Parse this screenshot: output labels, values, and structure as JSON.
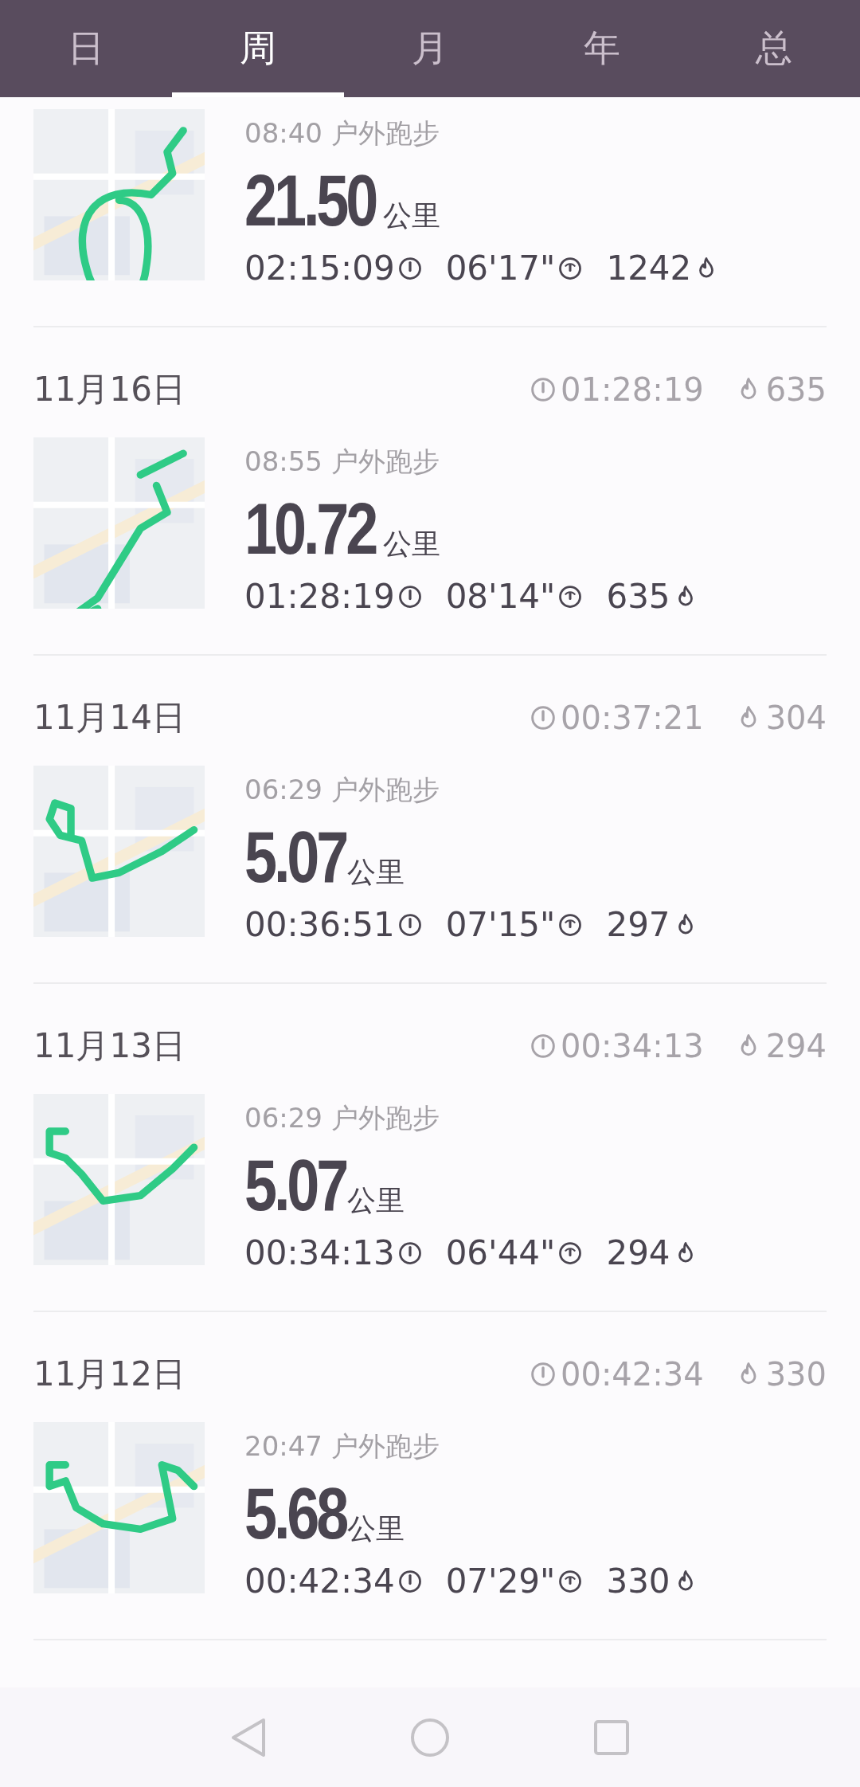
{
  "tabs": [
    {
      "label": "日",
      "selected": false
    },
    {
      "label": "周",
      "selected": true
    },
    {
      "label": "月",
      "selected": false
    },
    {
      "label": "年",
      "selected": false
    },
    {
      "label": "总",
      "selected": false
    }
  ],
  "days": [
    {
      "activities": [
        {
          "start": "08:40",
          "type": "户外跑步",
          "distance": "21.50",
          "unit": "公里",
          "duration": "02:15:09",
          "pace": "06'17\"",
          "calories": "1242"
        }
      ]
    },
    {
      "date": "11月16日",
      "total_duration": "01:28:19",
      "total_calories": "635",
      "activities": [
        {
          "start": "08:55",
          "type": "户外跑步",
          "distance": "10.72",
          "unit": "公里",
          "duration": "01:28:19",
          "pace": "08'14\"",
          "calories": "635"
        }
      ]
    },
    {
      "date": "11月14日",
      "total_duration": "00:37:21",
      "total_calories": "304",
      "activities": [
        {
          "start": "06:29",
          "type": "户外跑步",
          "distance": "5.07",
          "unit": "公里",
          "duration": "00:36:51",
          "pace": "07'15\"",
          "calories": "297"
        }
      ]
    },
    {
      "date": "11月13日",
      "total_duration": "00:34:13",
      "total_calories": "294",
      "activities": [
        {
          "start": "06:29",
          "type": "户外跑步",
          "distance": "5.07",
          "unit": "公里",
          "duration": "00:34:13",
          "pace": "06'44\"",
          "calories": "294"
        }
      ]
    },
    {
      "date": "11月12日",
      "total_duration": "00:42:34",
      "total_calories": "330",
      "activities": [
        {
          "start": "20:47",
          "type": "户外跑步",
          "distance": "5.68",
          "unit": "公里",
          "duration": "00:42:34",
          "pace": "07'29\"",
          "calories": "330"
        }
      ]
    }
  ]
}
